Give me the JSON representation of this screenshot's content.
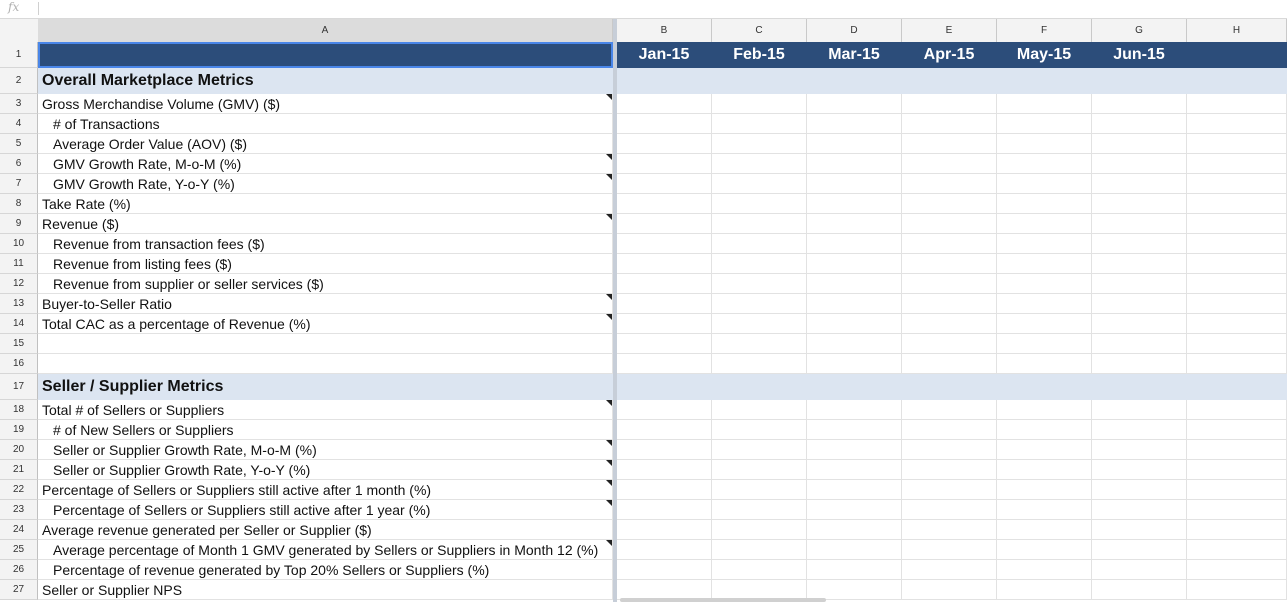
{
  "formula_bar": {
    "icon": "fx",
    "value": ""
  },
  "columns": [
    "A",
    "B",
    "C",
    "D",
    "E",
    "F",
    "G",
    "H"
  ],
  "months": [
    "Jan-15",
    "Feb-15",
    "Mar-15",
    "Apr-15",
    "May-15",
    "Jun-15",
    ""
  ],
  "rows": [
    {
      "num": "1",
      "label": "",
      "type": "header"
    },
    {
      "num": "2",
      "label": "Overall Marketplace Metrics",
      "type": "section"
    },
    {
      "num": "3",
      "label": "Gross Merchandise Volume (GMV) ($)",
      "indent": false,
      "note": true
    },
    {
      "num": "4",
      "label": "# of Transactions",
      "indent": true,
      "note": false
    },
    {
      "num": "5",
      "label": "Average Order Value (AOV) ($)",
      "indent": true,
      "note": false
    },
    {
      "num": "6",
      "label": "GMV Growth Rate, M-o-M (%)",
      "indent": true,
      "note": true
    },
    {
      "num": "7",
      "label": "GMV Growth Rate, Y-o-Y (%)",
      "indent": true,
      "note": true
    },
    {
      "num": "8",
      "label": "Take Rate (%)",
      "indent": false,
      "note": false
    },
    {
      "num": "9",
      "label": "Revenue ($)",
      "indent": false,
      "note": true
    },
    {
      "num": "10",
      "label": "Revenue from transaction fees ($)",
      "indent": true,
      "note": false
    },
    {
      "num": "11",
      "label": "Revenue from listing fees ($)",
      "indent": true,
      "note": false
    },
    {
      "num": "12",
      "label": "Revenue from supplier or seller services ($)",
      "indent": true,
      "note": false
    },
    {
      "num": "13",
      "label": "Buyer-to-Seller Ratio",
      "indent": false,
      "note": true
    },
    {
      "num": "14",
      "label": "Total CAC as a percentage of Revenue (%)",
      "indent": false,
      "note": true
    },
    {
      "num": "15",
      "label": "",
      "indent": false,
      "note": false
    },
    {
      "num": "16",
      "label": "",
      "indent": false,
      "note": false
    },
    {
      "num": "17",
      "label": "Seller / Supplier Metrics",
      "type": "section"
    },
    {
      "num": "18",
      "label": "Total # of Sellers or Suppliers",
      "indent": false,
      "note": true
    },
    {
      "num": "19",
      "label": "# of New Sellers or Suppliers",
      "indent": true,
      "note": false
    },
    {
      "num": "20",
      "label": "Seller or Supplier Growth Rate, M-o-M (%)",
      "indent": true,
      "note": true
    },
    {
      "num": "21",
      "label": "Seller or Supplier Growth Rate, Y-o-Y (%)",
      "indent": true,
      "note": true
    },
    {
      "num": "22",
      "label": "Percentage of Sellers or Suppliers still active after 1 month (%)",
      "indent": false,
      "note": true
    },
    {
      "num": "23",
      "label": "Percentage of Sellers or Suppliers still active after 1 year (%)",
      "indent": true,
      "note": true
    },
    {
      "num": "24",
      "label": "Average revenue generated per Seller or Supplier ($)",
      "indent": false,
      "note": false
    },
    {
      "num": "25",
      "label": "Average percentage of Month 1 GMV generated by Sellers or Suppliers in Month 12 (%)",
      "indent": true,
      "note": true
    },
    {
      "num": "26",
      "label": "Percentage of revenue generated by Top 20% Sellers or Suppliers (%)",
      "indent": true,
      "note": false
    },
    {
      "num": "27",
      "label": "Seller or Supplier NPS",
      "indent": false,
      "note": false
    }
  ]
}
